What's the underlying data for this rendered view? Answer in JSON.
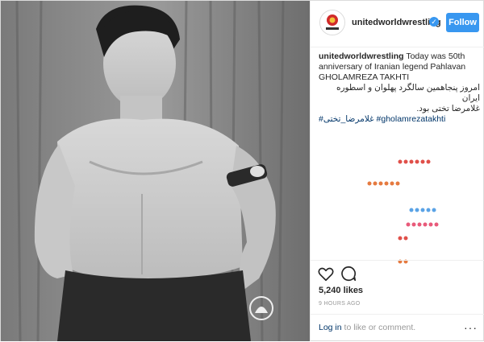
{
  "post": {
    "username": "unitedworldwrestling",
    "follow_label": "Follow",
    "caption_user": "unitedworldwrestling",
    "caption_text": "Today was 50th anniversary of Iranian legend Pahlavan GHOLAMREZA TAKHTI",
    "caption_fa_1": "امروز پنجاهمین سالگرد پهلوان و اسطوره ایران",
    "caption_fa_2": "غلامرضا تختی بود.",
    "hashtags": "#غلامرضا_تختی #gholamrezatakhti",
    "likes": "5,240 likes",
    "time": "9 HOURS AGO",
    "login_link": "Log in",
    "login_rest": " to like or comment.",
    "more": "···"
  },
  "colors": {
    "accent": "#3897f0",
    "link": "#003569",
    "emoji_red": "#e0504a",
    "emoji_blue": "#5aa3e6",
    "emoji_pink": "#e85a7a"
  },
  "icons": {
    "heart": "heart-icon",
    "comment": "comment-icon",
    "verified": "verified-badge-icon",
    "more": "more-options-icon"
  },
  "photo": {
    "subject": "black and white portrait",
    "logo_text": ""
  }
}
